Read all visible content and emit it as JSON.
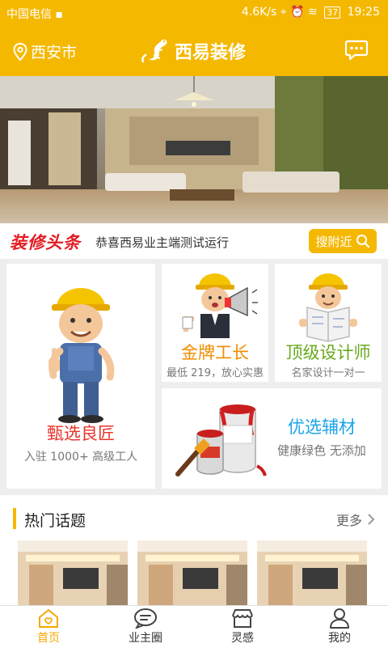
{
  "status_bar": {
    "carrier": "中国电信",
    "speed": "4.6K/s",
    "battery": "37",
    "time": "19:25"
  },
  "header": {
    "location": "西安市",
    "brand": "西易装修"
  },
  "news": {
    "logo_text": "装修头条",
    "headline": "恭喜西易业主端测试运行",
    "nearby_label": "搜附近"
  },
  "carousel": {
    "slide_count": 2,
    "active_index": 1
  },
  "cards": [
    {
      "title": "甄选良匠",
      "subtitle": "入驻 1000+ 高级工人",
      "color": "#e8332a"
    },
    {
      "title": "金牌工长",
      "subtitle": "最低 219，放心实惠",
      "color": "#f08c00"
    },
    {
      "title": "顶级设计师",
      "subtitle": "名家设计一对一",
      "color": "#68a81c"
    },
    {
      "title": "优选辅材",
      "subtitle": "健康绿色 无添加",
      "color": "#1aa4e8"
    }
  ],
  "section": {
    "title": "热门话题",
    "more_label": "更多"
  },
  "tabs": [
    {
      "label": "首页",
      "icon": "home-icon",
      "active": true
    },
    {
      "label": "业主圈",
      "icon": "chat-icon",
      "active": false
    },
    {
      "label": "灵感",
      "icon": "store-icon",
      "active": false
    },
    {
      "label": "我的",
      "icon": "user-icon",
      "active": false
    }
  ],
  "colors": {
    "brand": "#f5b800",
    "active_tab": "#f5a800"
  }
}
